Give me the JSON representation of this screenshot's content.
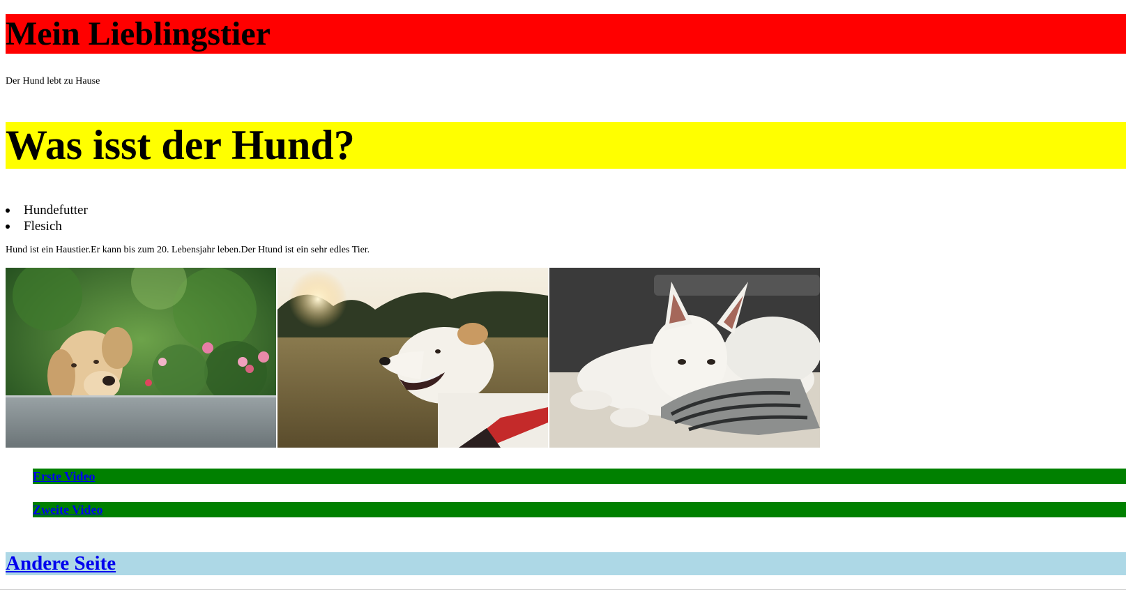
{
  "header": {
    "title": "Mein Lieblingstier"
  },
  "intro": {
    "text": "Der Hund lebt zu Hause"
  },
  "food": {
    "heading": "Was isst der Hund?",
    "items": [
      "Hundefutter",
      "Flesich"
    ]
  },
  "description": {
    "text": "Hund ist ein Haustier.Er kann bis zum 20. Lebensjahr leben.Der Htund ist ein sehr edles Tier."
  },
  "gallery": {
    "photos": [
      "labrador-on-table",
      "white-dog-sunset-field",
      "white-shepherd-on-blanket"
    ]
  },
  "videos": {
    "first_label": "Erste Video",
    "second_label": "Zweite Video"
  },
  "other_page": {
    "label": "Andere Seite"
  },
  "colors": {
    "title_bg": "#ff0000",
    "food_bg": "#ffff00",
    "video_bg": "#008000",
    "other_bg": "#add8e6",
    "link": "#0000ee"
  }
}
